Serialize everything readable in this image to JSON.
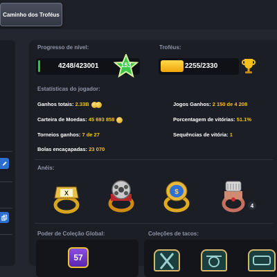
{
  "header": {
    "tab_label": "Caminho dos Troféus"
  },
  "level_progress": {
    "title": "Progresso de nível:",
    "value": "4248/423001",
    "level": "153"
  },
  "trophies": {
    "title": "Troféus:",
    "value": "2255/2330"
  },
  "stats": {
    "title": "Estatísticas do jogador:",
    "total_earnings_label": "Ganhos totais:",
    "total_earnings_value": "2.33B",
    "wallet_label": "Carteira de Moedas:",
    "wallet_value": "45 693 858",
    "tournaments_label": "Torneios ganhos:",
    "tournaments_value": "7 de 27",
    "balls_label": "Bolas encaçapadas:",
    "balls_value": "23 070",
    "games_won_label": "Jogos Ganhos:",
    "games_won_value": "2 150 de 4 208",
    "win_pct_label": "Porcentagem de vitórias:",
    "win_pct_value": "51.1%",
    "streak_label": "Sequências de vitória:",
    "streak_value": "1"
  },
  "rings": {
    "title": "Anéis:",
    "last_ring_count": "4"
  },
  "collection": {
    "title": "Poder de Coleção Global:",
    "power": "57"
  },
  "cues": {
    "title": "Coleções de tacos:"
  },
  "colors": {
    "accent_gold": "#f5c21b",
    "progress_green": "#2cc64b",
    "panel": "#1c1e25"
  }
}
